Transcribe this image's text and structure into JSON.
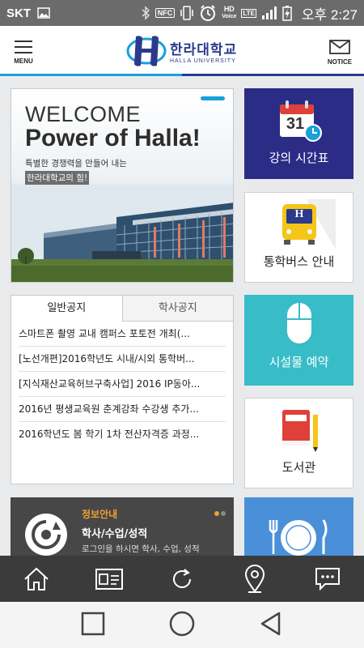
{
  "status_bar": {
    "carrier": "SKT",
    "nfc": "NFC",
    "hd": "HD",
    "voice": "Voice",
    "lte": "LTE",
    "time": "오후 2:27"
  },
  "header": {
    "menu_label": "MENU",
    "notice_label": "NOTICE",
    "logo_ko": "한라대학교",
    "logo_en": "HALLA UNIVERSITY"
  },
  "banner": {
    "line1": "WELCOME",
    "line2": "Power of Halla!",
    "line3": "특별한 경쟁력을 만들어 내는",
    "line4": "한라대학교의 힘!"
  },
  "notice": {
    "tabs": [
      {
        "label": "일반공지"
      },
      {
        "label": "학사공지"
      }
    ],
    "items": [
      "스마트폰 촬영 교내 캠퍼스 포토전 개최(...",
      "[노선개편]2016학년도 시내/시외 통학버...",
      "[지식재산교육허브구축사업] 2016 IP동아...",
      "2016년 평생교육원 춘계강좌 수강생 추가...",
      "2016학년도 봄 학기 1차 전산자격증 과정..."
    ]
  },
  "tiles": {
    "schedule": {
      "label": "강의 시간표",
      "calendar_day": "31"
    },
    "bus": {
      "label": "통학버스 안내",
      "bus_mark": "H"
    },
    "facility": {
      "label": "시설물 예약"
    },
    "library": {
      "label": "도서관"
    }
  },
  "info": {
    "title": "정보안내",
    "subtitle": "학사/수업/성적",
    "desc": "로그인을 하시면 학사, 수업, 성적"
  },
  "colors": {
    "brand_navy": "#2b2c86",
    "brand_blue": "#1aa0db",
    "teal": "#37bcc8",
    "orange": "#f0a030"
  },
  "toolbar": [
    "home-icon",
    "id-card-icon",
    "refresh-icon",
    "location-pin-icon",
    "chat-icon"
  ],
  "navbar": [
    "recent-apps-icon",
    "home-circle-icon",
    "back-icon"
  ]
}
